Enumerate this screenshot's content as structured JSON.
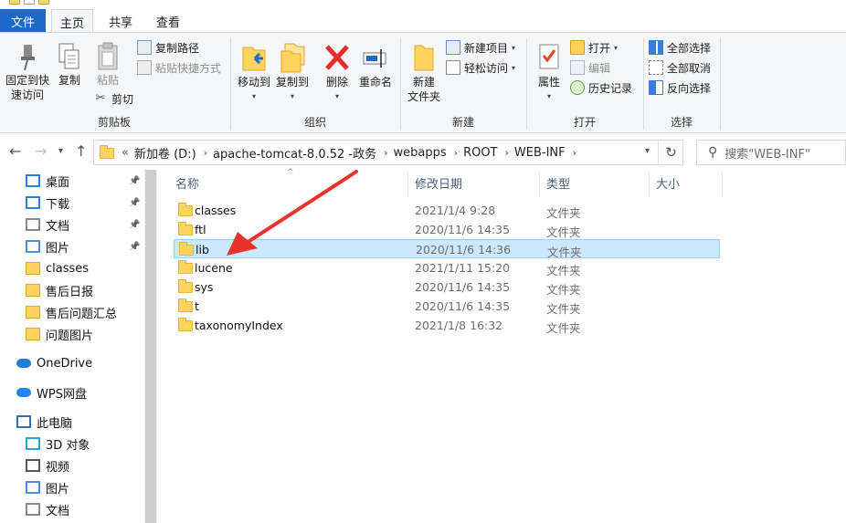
{
  "ribbon_tabs": {
    "file": "文件",
    "home": "主页",
    "share": "共享",
    "view": "查看"
  },
  "clipboard": {
    "pin": "固定到快\n速访问",
    "copy": "复制",
    "paste": "粘贴",
    "copy_path": "复制路径",
    "paste_shortcut": "粘贴快捷方式",
    "cut": "剪切",
    "label": "剪贴板"
  },
  "organize": {
    "move_to": "移动到",
    "copy_to": "复制到",
    "delete": "删除",
    "rename": "重命名",
    "label": "组织"
  },
  "new": {
    "new_folder": "新建\n文件夹",
    "new_item": "新建项目",
    "easy_access": "轻松访问",
    "label": "新建"
  },
  "open": {
    "properties": "属性",
    "open": "打开",
    "edit": "编辑",
    "history": "历史记录",
    "label": "打开"
  },
  "select": {
    "select_all": "全部选择",
    "select_none": "全部取消",
    "invert": "反向选择",
    "label": "选择"
  },
  "address": {
    "overflow": "«",
    "crumbs": [
      "新加卷 (D:)",
      "apache-tomcat-8.0.52 -政务",
      "webapps",
      "ROOT",
      "WEB-INF"
    ],
    "search_placeholder": "搜索\"WEB-INF\""
  },
  "nav_pane": {
    "items": [
      {
        "label": "桌面",
        "icon": "desktop-icon",
        "pinned": true
      },
      {
        "label": "下载",
        "icon": "download-icon",
        "pinned": true
      },
      {
        "label": "文档",
        "icon": "documents-icon",
        "pinned": true
      },
      {
        "label": "图片",
        "icon": "pictures-icon",
        "pinned": true
      },
      {
        "label": "classes",
        "icon": "folder-icon",
        "pinned": false
      },
      {
        "label": "售后日报",
        "icon": "folder-icon",
        "pinned": false
      },
      {
        "label": "售后问题汇总",
        "icon": "folder-icon",
        "pinned": false
      },
      {
        "label": "问题图片",
        "icon": "folder-icon",
        "pinned": false
      },
      {
        "label": "OneDrive",
        "icon": "cloud-icon",
        "pinned": false
      },
      {
        "label": "WPS网盘",
        "icon": "wps-cloud-icon",
        "pinned": false
      },
      {
        "label": "此电脑",
        "icon": "computer-icon",
        "pinned": false
      },
      {
        "label": "3D 对象",
        "icon": "3d-objects-icon",
        "pinned": false
      },
      {
        "label": "视频",
        "icon": "video-icon",
        "pinned": false
      },
      {
        "label": "图片",
        "icon": "pictures-icon",
        "pinned": false
      },
      {
        "label": "文档",
        "icon": "documents-icon",
        "pinned": false
      }
    ]
  },
  "file_list": {
    "columns": {
      "name": "名称",
      "date": "修改日期",
      "type": "类型",
      "size": "大小"
    },
    "rows": [
      {
        "name": "classes",
        "date": "2021/1/4 9:28",
        "type": "文件夹",
        "selected": false
      },
      {
        "name": "ftl",
        "date": "2020/11/6 14:35",
        "type": "文件夹",
        "selected": false
      },
      {
        "name": "lib",
        "date": "2020/11/6 14:36",
        "type": "文件夹",
        "selected": true
      },
      {
        "name": "lucene",
        "date": "2021/1/11 15:20",
        "type": "文件夹",
        "selected": false
      },
      {
        "name": "sys",
        "date": "2020/11/6 14:35",
        "type": "文件夹",
        "selected": false
      },
      {
        "name": "t",
        "date": "2020/11/6 14:35",
        "type": "文件夹",
        "selected": false
      },
      {
        "name": "taxonomyIndex",
        "date": "2021/1/8 16:32",
        "type": "文件夹",
        "selected": false
      }
    ]
  },
  "annotation": {
    "color": "#e8332b"
  }
}
